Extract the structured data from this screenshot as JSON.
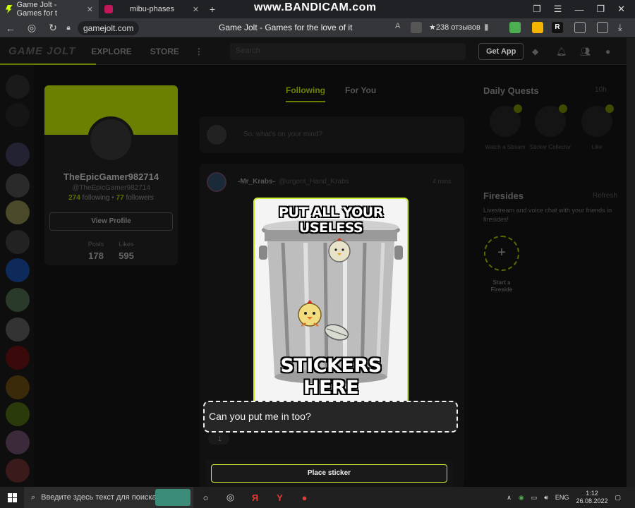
{
  "browser": {
    "tabs": [
      {
        "title": "Game Jolt - Games for t",
        "active": true
      },
      {
        "title": "mibu-phases",
        "active": false
      }
    ],
    "recorder_watermark": "www.BANDICAM.com",
    "url": "gamejolt.com",
    "page_title": "Game Jolt - Games for the love of it",
    "rating": "★238 отзывов",
    "extension_letter": "R"
  },
  "site": {
    "logo": "GAME JOLT",
    "nav": [
      "EXPLORE",
      "STORE"
    ],
    "get_app": "Get App",
    "search_placeholder": "Search"
  },
  "profile": {
    "name": "TheEpicGamer982714",
    "handle": "@TheEpicGamer982714",
    "following_count": "274",
    "following_label": "following",
    "followers_count": "77",
    "followers_label": "followers",
    "view_profile": "View Profile",
    "stats": [
      {
        "label": "Posts",
        "value": "178"
      },
      {
        "label": "Likes",
        "value": "595"
      }
    ]
  },
  "feed": {
    "tabs": [
      "Following",
      "For You"
    ],
    "active_tab": "Following",
    "composer_placeholder": "So, what's on your mind?",
    "post": {
      "author": "-Mr_Krabs-",
      "handle": "@urgent_Hand_Krabs",
      "time": "4 mins",
      "reaction_count": "1"
    }
  },
  "daily_quests": {
    "title": "Daily Quests",
    "timer": "10h",
    "quests": [
      {
        "label": "Watch a Stream"
      },
      {
        "label": "Sticker Collector"
      },
      {
        "label": "Like"
      }
    ]
  },
  "firesides": {
    "title": "Firesides",
    "refresh": "Refresh",
    "description": "Livestream and voice chat with your friends in firesides!",
    "start_label": "Start a Fireside"
  },
  "sticker_modal": {
    "meme_top": "PUT ALL YOUR USELESS",
    "meme_bottom": "STICKERS HERE",
    "caption": "Can you put me in too?",
    "place_button": "Place sticker"
  },
  "taskbar": {
    "search_placeholder": "Введите здесь текст для поиска",
    "language": "ENG",
    "time": "1:12",
    "date": "26.08.2022"
  },
  "colors": {
    "accent": "#c9ef2e",
    "accent_dim": "#6b7d00",
    "background": "#0b0b0b"
  }
}
